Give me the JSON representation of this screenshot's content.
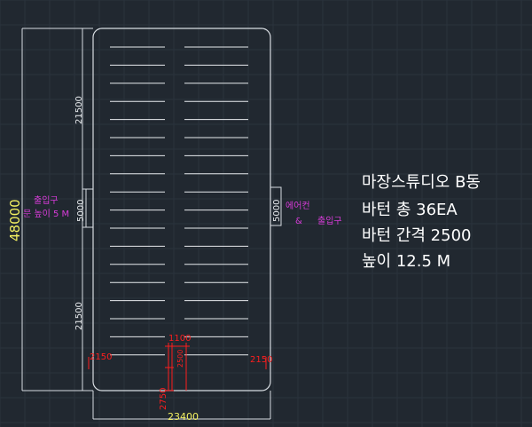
{
  "colors": {
    "background": "#212830",
    "grid": "#2b333d",
    "outline": "#d8dde2",
    "dimension": "#e8ebee",
    "total_dim": "#f3f061",
    "red_dim": "#ff1e1e",
    "magenta": "#d73bd8",
    "info": "#ffffff"
  },
  "dimensions": {
    "total_length": "48000",
    "total_width": "23400",
    "upper_segment": "21500",
    "lower_segment": "21500",
    "left_entrance": "5000",
    "right_entrance": "5000",
    "center_width": "1100",
    "left_margin": "2150",
    "right_margin": "2150",
    "pitch": "2500",
    "bottom_gap": "2750"
  },
  "labels": {
    "left_entrance_line1": "출입구",
    "left_entrance_line2": "문 높이 5 M",
    "right_entrance_line1": "에어컨",
    "right_entrance_line2": "&",
    "right_entrance_line3": "출입구"
  },
  "info": {
    "title": "마장스튜디오 B동",
    "batten_count": "바턴 총 36EA",
    "batten_spacing": "바턴 간격 2500",
    "height": "높이 12.5 M"
  },
  "battens": {
    "columns": 2,
    "per_column": 18
  }
}
